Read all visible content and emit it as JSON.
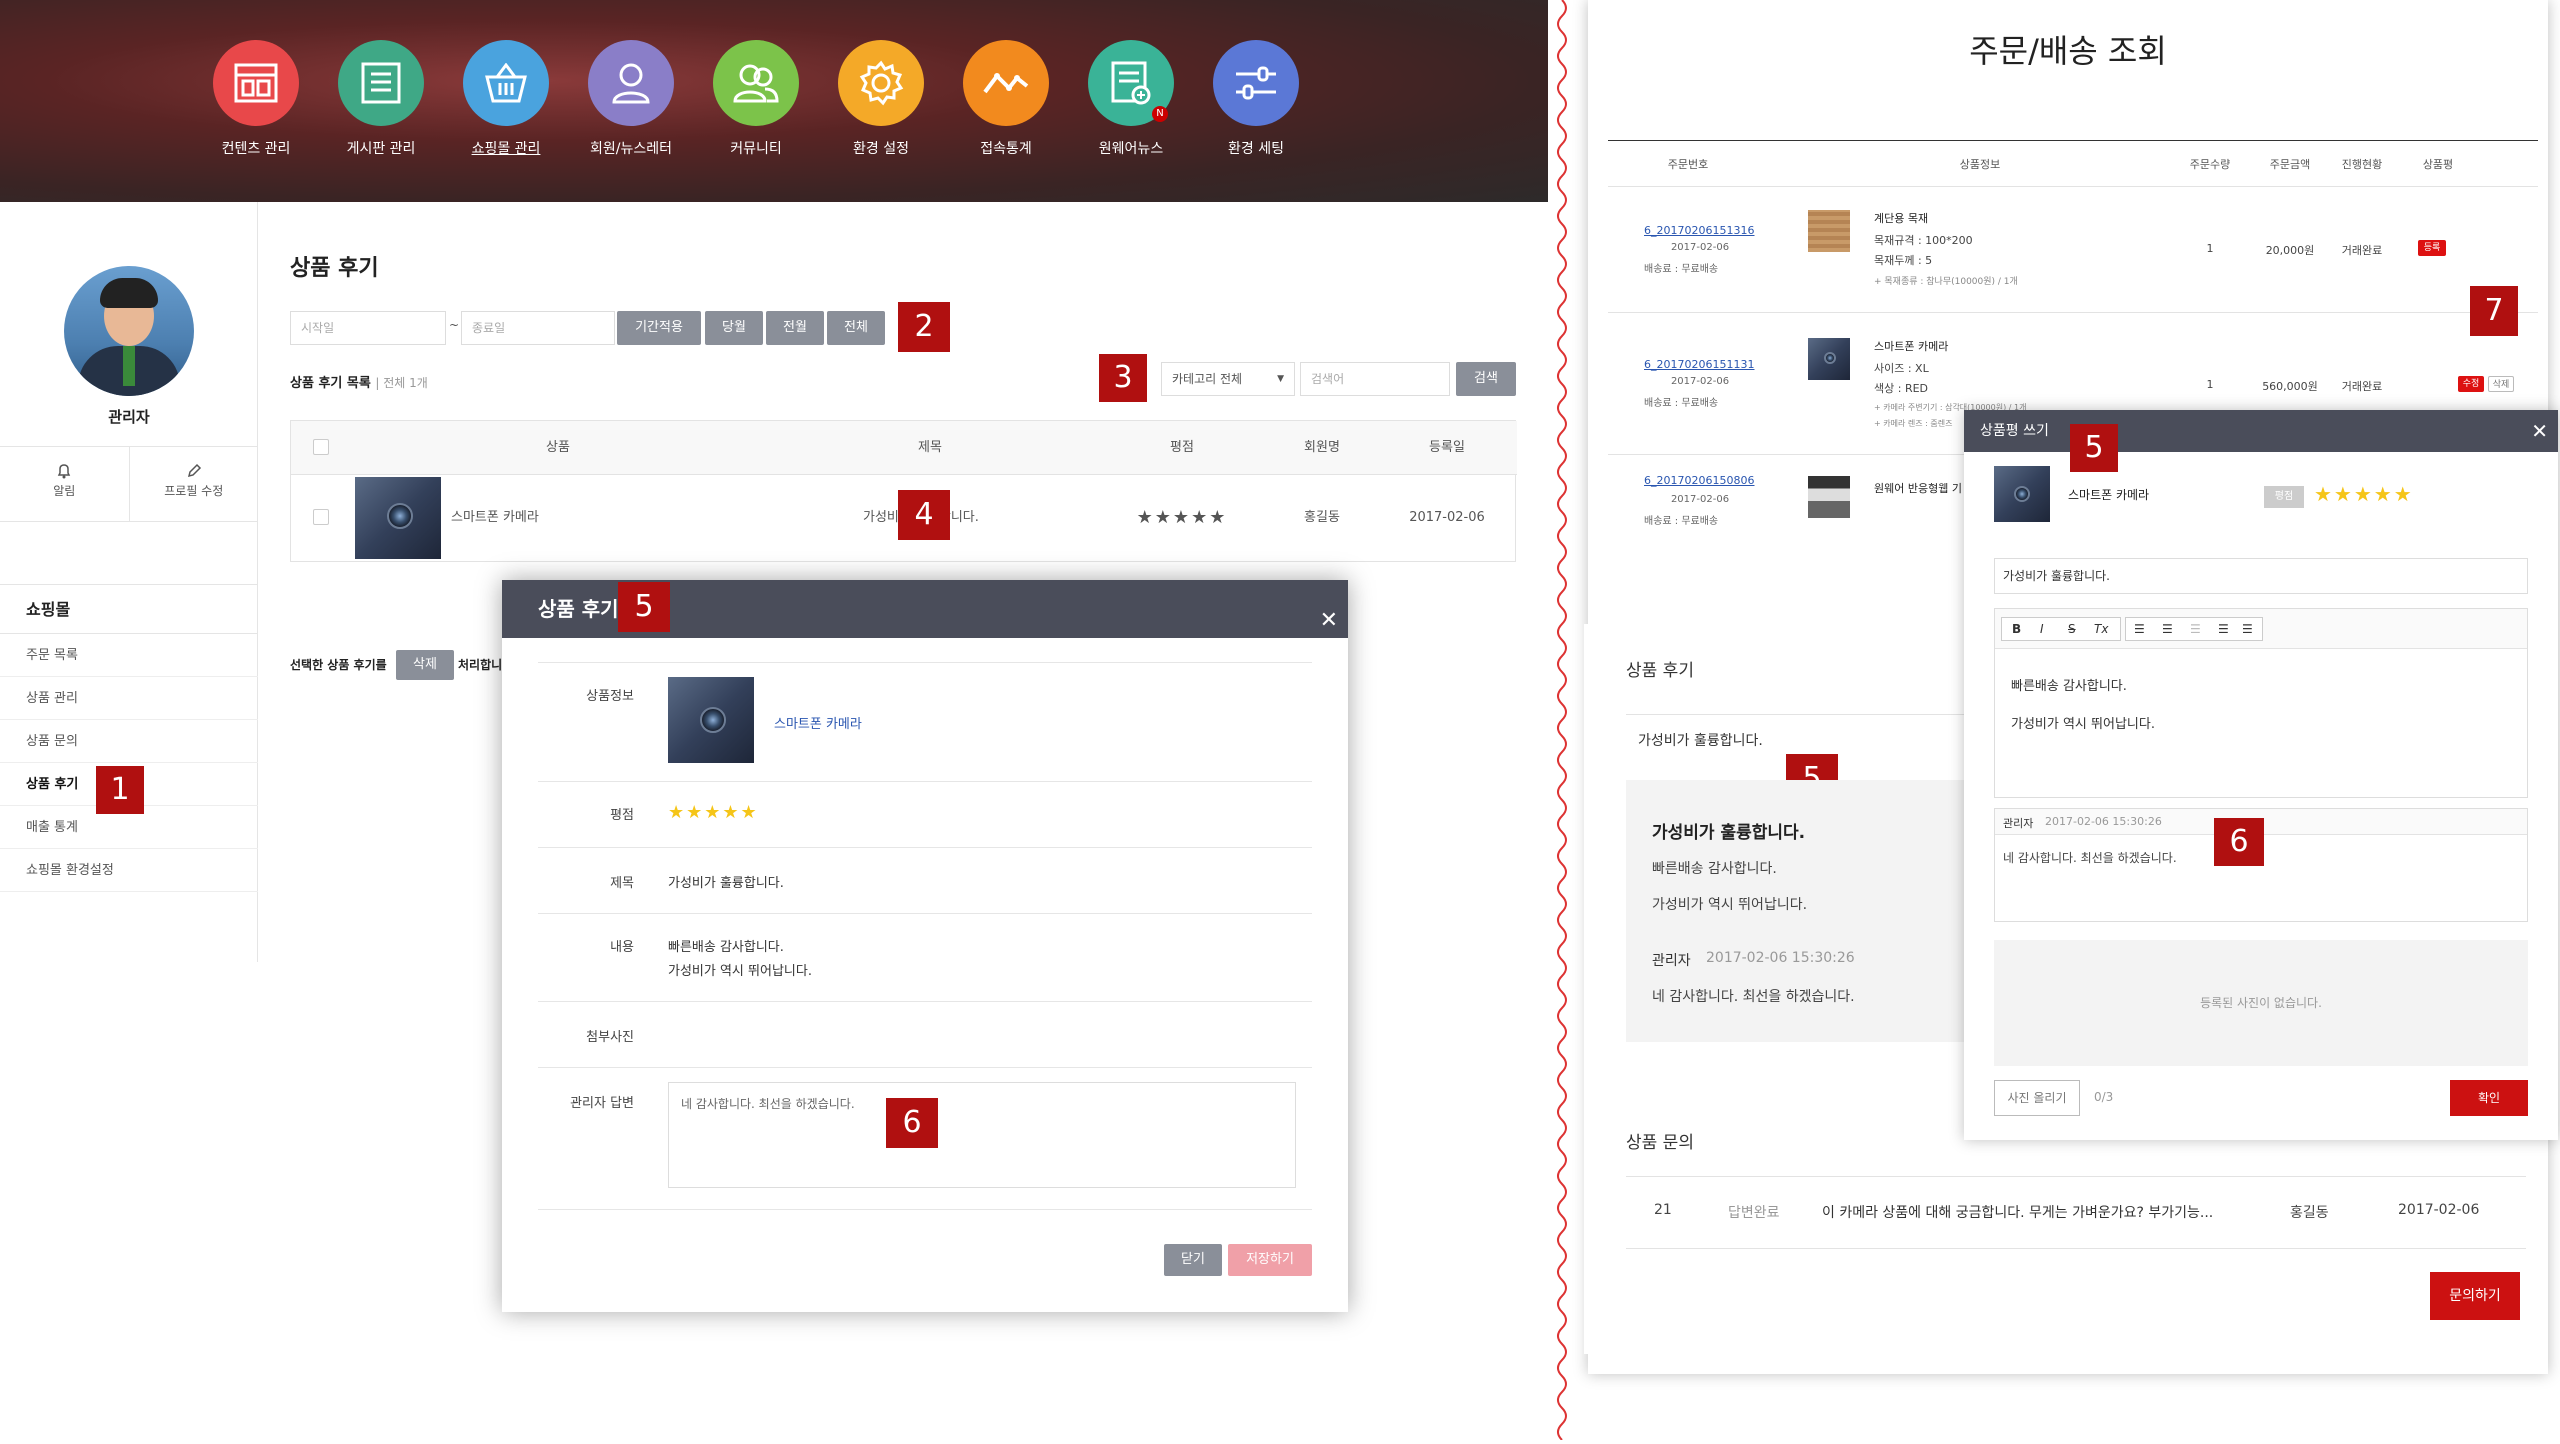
{
  "nav": [
    {
      "label": "컨텐츠 관리",
      "icon": "layout-icon",
      "color": "#e8484a"
    },
    {
      "label": "게시판 관리",
      "icon": "list-icon",
      "color": "#3fa886"
    },
    {
      "label": "쇼핑몰 관리",
      "icon": "basket-icon",
      "color": "#4aa3de"
    },
    {
      "label": "회원/뉴스레터",
      "icon": "user-icon",
      "color": "#8a7ec8"
    },
    {
      "label": "커뮤니티",
      "icon": "users-icon",
      "color": "#7cc34a"
    },
    {
      "label": "환경 설정",
      "icon": "gear-icon",
      "color": "#f4a928"
    },
    {
      "label": "접속통계",
      "icon": "chart-line-icon",
      "color": "#f28a1e"
    },
    {
      "label": "원웨어뉴스",
      "icon": "news-icon",
      "color": "#3ab397"
    },
    {
      "label": "환경 세팅",
      "icon": "sliders-icon",
      "color": "#5b78d6"
    }
  ],
  "nav_badge": "N",
  "sidebar": {
    "user_name": "관리자",
    "tabs": [
      "알림",
      "프로필 수정"
    ],
    "menu_title": "쇼핑몰",
    "menu": [
      "주문 목록",
      "상품 관리",
      "상품 문의",
      "상품 후기",
      "매출 통계",
      "쇼핑몰 환경설정"
    ]
  },
  "main": {
    "title": "상품 후기",
    "start_placeholder": "시작일",
    "tilde": "~",
    "end_placeholder": "종료일",
    "period_buttons": [
      "기간적용",
      "당월",
      "전월",
      "전체"
    ],
    "list_title": "상품 후기 목록",
    "list_count": "| 전체 1개",
    "category": "카테고리 전체",
    "search_placeholder": "검색어",
    "search_btn": "검색",
    "columns": [
      "상품",
      "제목",
      "평점",
      "회원명",
      "등록일"
    ],
    "row": {
      "product": "스마트폰 카메라",
      "title": "가성비가 훌륭합니다.",
      "rating": "★★★★★",
      "member": "홍길동",
      "date": "2017-02-06"
    },
    "bulk_text": "선택한 상품 후기를",
    "bulk_btn": "삭제",
    "bulk_tail": "처리합니"
  },
  "modal_left": {
    "title": "상품 후기",
    "labels": {
      "product": "상품정보",
      "rating": "평점",
      "title": "제목",
      "content": "내용",
      "photo": "첨부사진",
      "reply": "관리자 답변"
    },
    "product": "스마트폰 카메라",
    "rating": "★★★★★",
    "title_val": "가성비가 훌륭합니다.",
    "content1": "빠른배송 감사합니다.",
    "content2": "가성비가 역시 뛰어납니다.",
    "reply": "네 감사합니다. 최선을 하겠습니다.",
    "close_btn": "닫기",
    "save_btn": "저장하기"
  },
  "callouts": [
    "1",
    "2",
    "3",
    "4",
    "5",
    "6",
    "7"
  ],
  "orders": {
    "title": "주문/배송 조회",
    "columns": [
      "주문번호",
      "상품정보",
      "주문수량",
      "주문금액",
      "진행현황",
      "상품평"
    ],
    "rows": [
      {
        "no": "6_20170206151316",
        "date": "2017-02-06",
        "ship": "배송료 : 무료배송",
        "name": "계단용 목재",
        "opt1": "목재규격 : 100*200",
        "opt2": "목재두께 : 5",
        "opt3": "+ 목재종류 : 참나무(10000원) / 1개",
        "qty": "1",
        "price": "20,000원",
        "status": "거래완료",
        "review": "등록"
      },
      {
        "no": "6_20170206151131",
        "date": "2017-02-06",
        "ship": "배송료 : 무료배송",
        "name": "스마트폰 카메라",
        "opt1": "사이즈 : XL",
        "opt2": "색상 : RED",
        "opt3": "+ 카메라 주변기기 : 삼각대(10000원) / 1개",
        "opt4": "+ 카메라 렌즈 : 줌렌즈",
        "qty": "1",
        "price": "560,000원",
        "status": "거래완료",
        "review_edit": "수정",
        "review_del": "삭제"
      },
      {
        "no": "6_20170206150806",
        "date": "2017-02-06",
        "ship": "배송료 : 무료배송",
        "name": "원웨어 반응형웹 기"
      }
    ]
  },
  "review_section": {
    "title": "상품 후기",
    "item_title": "가성비가 훌륭합니다.",
    "detail_title": "가성비가 훌륭합니다.",
    "line1": "빠른배송 감사합니다.",
    "line2": "가성비가 역시 뛰어납니다.",
    "admin": "관리자",
    "admin_date": "2017-02-06 15:30:26",
    "admin_reply": "네 감사합니다. 최선을 하겠습니다."
  },
  "inquiry": {
    "title": "상품 문의",
    "no": "21",
    "status": "답변완료",
    "subject": "이 카메라 상품에 대해 궁금합니다. 무게는 가벼운가요? 부가기능...",
    "member": "홍길동",
    "date": "2017-02-06",
    "button": "문의하기"
  },
  "write_modal": {
    "title": "상품평 쓰기",
    "product": "스마트폰 카메라",
    "rating_label": "평점",
    "rating": "★★★★★",
    "title_val": "가성비가 훌륭합니다.",
    "toolbar": [
      "B",
      "I",
      "S",
      "Tx"
    ],
    "body1": "빠른배송 감사합니다.",
    "body2": "가성비가 역시 뛰어납니다.",
    "admin": "관리자",
    "admin_date": "2017-02-06 15:30:26",
    "admin_reply": "네 감사합니다. 최선을 하겠습니다.",
    "no_photo": "등록된 사진이 없습니다.",
    "upload_btn": "사진 올리기",
    "photo_count": "0/3",
    "confirm_btn": "확인"
  }
}
